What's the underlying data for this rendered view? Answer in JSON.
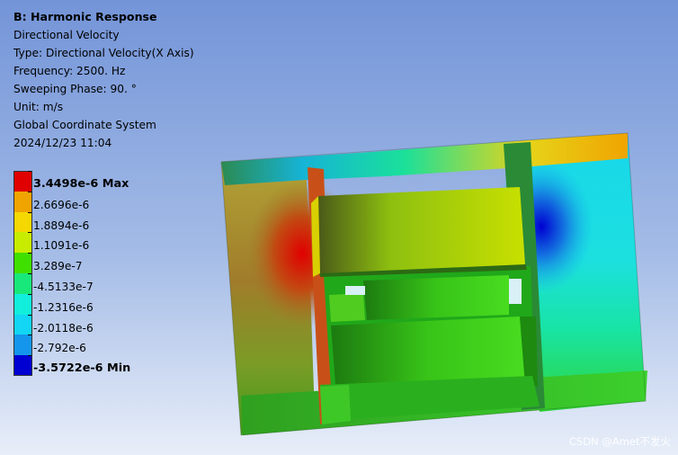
{
  "info": {
    "title": "B: Harmonic Response",
    "result": "Directional Velocity",
    "type": "Type: Directional Velocity(X Axis)",
    "frequency": "Frequency: 2500. Hz",
    "phase": "Sweeping Phase: 90. °",
    "unit": "Unit: m/s",
    "coord": "Global Coordinate System",
    "date": "2024/12/23 11:04"
  },
  "legend": [
    {
      "label": "3.4498e-6 Max",
      "color": "#e00000",
      "strong": true
    },
    {
      "label": "2.6696e-6",
      "color": "#f0a400",
      "strong": false
    },
    {
      "label": "1.8894e-6",
      "color": "#f4d800",
      "strong": false
    },
    {
      "label": "1.1091e-6",
      "color": "#c8ec00",
      "strong": false
    },
    {
      "label": "3.289e-7",
      "color": "#3fe000",
      "strong": false
    },
    {
      "label": "-4.5133e-7",
      "color": "#18e87a",
      "strong": false
    },
    {
      "label": "-1.2316e-6",
      "color": "#12eedc",
      "strong": false
    },
    {
      "label": "-2.0118e-6",
      "color": "#12d6f4",
      "strong": false
    },
    {
      "label": "-2.792e-6",
      "color": "#1496ec",
      "strong": false
    },
    {
      "label": "-3.5722e-6 Min",
      "color": "#0000d2",
      "strong": true
    }
  ],
  "watermark": "CSDN @Amet不发火"
}
